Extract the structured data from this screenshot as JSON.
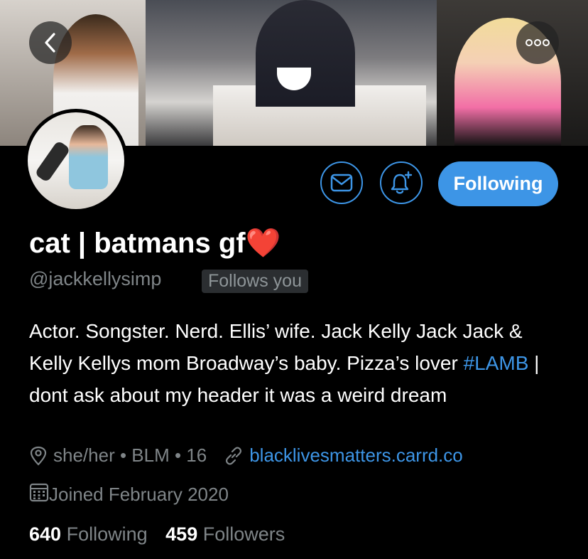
{
  "profile": {
    "name": "cat | batmans gf",
    "name_emoji": "❤️",
    "handle": "@jackkellysimp",
    "follows_you_badge": "Follows you",
    "bio_before_hashtag": "Actor. Songster. Nerd. Ellis’ wife. Jack Kelly Jack Jack & Kelly Kellys mom Broadway’s baby. Pizza’s lover ",
    "bio_hashtag": "#LAMB",
    "bio_after_hashtag": " | dont ask about my header it was a weird dream",
    "location": "she/her • BLM • 16",
    "website": "blacklivesmatters.carrd.co",
    "joined": "Joined February 2020",
    "following_count": "640",
    "following_label": "Following",
    "followers_count": "459",
    "followers_label": "Followers"
  },
  "actions": {
    "follow_button_label": "Following"
  },
  "icons": {
    "back": "chevron-left-icon",
    "more": "more-horizontal-icon",
    "message": "envelope-icon",
    "notifications": "bell-plus-icon",
    "location": "location-pin-icon",
    "link": "link-icon",
    "calendar": "calendar-icon"
  },
  "colors": {
    "accent": "#3d95e6",
    "muted_text": "#7f8588",
    "background": "#000000",
    "badge_bg": "#2b2e31"
  }
}
